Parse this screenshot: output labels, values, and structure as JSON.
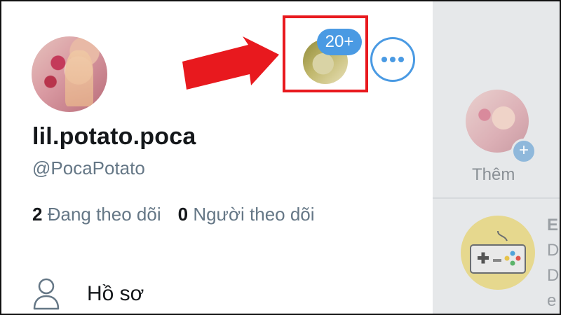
{
  "profile": {
    "display_name": "lil.potato.poca",
    "handle": "@PocaPotato",
    "following_count": "2",
    "following_label": "Đang theo dõi",
    "followers_count": "0",
    "followers_label": "Người theo dõi"
  },
  "account_switcher": {
    "badge": "20+"
  },
  "menu": {
    "items": [
      {
        "label": "Hồ sơ",
        "icon": "person-icon"
      }
    ]
  },
  "side_panel": {
    "add_label": "Thêm",
    "add_symbol": "+",
    "cut_letters": [
      "E",
      "D",
      "D",
      "e"
    ]
  },
  "colors": {
    "accent": "#4a9ae3",
    "highlight": "#e8191e",
    "text_primary": "#14171a",
    "text_secondary": "#657786",
    "backdrop": "#e6e8ea"
  }
}
